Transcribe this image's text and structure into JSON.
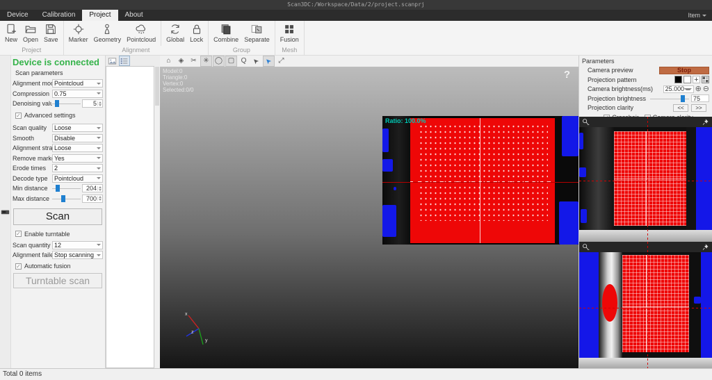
{
  "window": {
    "title": "Scan3DC:/Workspace/Data/2/project.scanprj"
  },
  "menu": {
    "tabs": [
      {
        "label": "Device",
        "active": false
      },
      {
        "label": "Calibration",
        "active": false
      },
      {
        "label": "Project",
        "active": true
      },
      {
        "label": "About",
        "active": false
      }
    ],
    "right_item": "Item"
  },
  "ribbon": {
    "groups": [
      {
        "label": "Project",
        "sections": [
          [
            {
              "label": "New",
              "icon": "new-icon"
            },
            {
              "label": "Open",
              "icon": "open-icon"
            },
            {
              "label": "Save",
              "icon": "save-icon"
            }
          ]
        ]
      },
      {
        "label": "Alignment",
        "sections": [
          [
            {
              "label": "Marker",
              "icon": "marker-icon"
            },
            {
              "label": "Geometry",
              "icon": "geometry-icon"
            },
            {
              "label": "Pointcloud",
              "icon": "pointcloud-icon"
            }
          ],
          [
            {
              "label": "Global",
              "icon": "global-icon"
            },
            {
              "label": "Lock",
              "icon": "lock-icon"
            }
          ]
        ]
      },
      {
        "label": "Group",
        "sections": [
          [
            {
              "label": "Combine",
              "icon": "combine-icon"
            },
            {
              "label": "Separate",
              "icon": "separate-icon"
            }
          ]
        ]
      },
      {
        "label": "Mesh",
        "sections": [
          [
            {
              "label": "Fusion",
              "icon": "fusion-icon"
            }
          ]
        ]
      }
    ]
  },
  "left_panel": {
    "device_status": "Device is connected",
    "section_title": "Scan parameters",
    "rows": [
      {
        "type": "select",
        "label": "Alignment mode",
        "value": "Pointcloud"
      },
      {
        "type": "select",
        "label": "Compression",
        "value": "0.75"
      },
      {
        "type": "sliderspin",
        "label": "Denoising value",
        "value": "5",
        "pos": 9
      },
      {
        "type": "checkbox",
        "label": "Advanced settings",
        "checked": true
      },
      {
        "type": "select",
        "label": "Scan quality",
        "value": "Loose"
      },
      {
        "type": "select",
        "label": "Smooth",
        "value": "Disable"
      },
      {
        "type": "select",
        "label": "Alignment strateg",
        "value": "Loose"
      },
      {
        "type": "select",
        "label": "Remove markers",
        "value": "Yes"
      },
      {
        "type": "select",
        "label": "Erode times",
        "value": "2"
      },
      {
        "type": "select",
        "label": "Decode type",
        "value": "Pointcloud"
      },
      {
        "type": "sliderspin",
        "label": "Min distance",
        "value": "204",
        "pos": 12
      },
      {
        "type": "sliderspin",
        "label": "Max distance",
        "value": "700",
        "pos": 32
      }
    ],
    "scan_button": "Scan",
    "turntable": {
      "rows": [
        {
          "type": "checkbox",
          "label": "Enable turntable",
          "checked": true
        },
        {
          "type": "select",
          "label": "Scan quantity",
          "value": "12"
        },
        {
          "type": "select",
          "label": "Alignment failed",
          "value": "Stop scanning"
        },
        {
          "type": "checkbox",
          "label": "Automatic fusion",
          "checked": true
        }
      ],
      "button": "Turntable scan"
    }
  },
  "viewport": {
    "toolbar": [
      {
        "name": "home-icon",
        "glyph": "⌂",
        "active": false
      },
      {
        "name": "standard-view-icon",
        "glyph": "◈",
        "active": false
      },
      {
        "name": "cut-icon",
        "glyph": "✂",
        "active": false
      },
      {
        "name": "pan-icon",
        "glyph": "✳",
        "active": true
      },
      {
        "name": "circle-select-icon",
        "glyph": "◯",
        "active": true
      },
      {
        "name": "polygon-select-icon",
        "glyph": "▢",
        "active": true
      },
      {
        "name": "lasso-select-icon",
        "glyph": "Q",
        "active": false
      },
      {
        "name": "pick-rect-icon",
        "glyph": "➤",
        "active": false,
        "rotate": -135
      },
      {
        "name": "pick-move-icon",
        "glyph": "➤",
        "active": true,
        "rotate": -135,
        "color": "#2a7fd4"
      },
      {
        "name": "fit-view-icon",
        "glyph": "⤢",
        "active": false
      }
    ],
    "stats": [
      "Model:0",
      "Triangle:0",
      "Vertex:0",
      "Selected:0/0"
    ],
    "help": "?",
    "camera_overlay": {
      "ratio_label": "Ratio: 100.0%"
    },
    "axis": {
      "x": "x",
      "y": "y",
      "z": "z"
    }
  },
  "right_panel": {
    "title": "Parameters",
    "camera_preview_label": "Camera preview",
    "stop_button": "Stop",
    "projection_pattern_label": "Projection pattern",
    "pattern_plus": "+",
    "camera_brightness_label": "Camera brightness(ms)",
    "camera_brightness_value": "25.000",
    "brightness_inc": "⊕",
    "brightness_dec": "⊖",
    "projection_brightness_label": "Projection brightness",
    "projection_brightness_value": "75",
    "projection_clarity_label": "Projection clarity",
    "clarity_dec": "<<",
    "clarity_inc": ">>",
    "crosshair_label": "Crosshair",
    "crosshair_checked": true,
    "camera_clarity_label": "Camera clarity",
    "camera_clarity_checked": false
  },
  "status_bar": {
    "text": "Total 0 items"
  },
  "colors": {
    "status_green": "#35b34a",
    "stop_orange": "#bf6b43",
    "slider_blue": "#1f80d0",
    "scan_red": "#ee0707",
    "scan_blue": "#1417e8",
    "ratio_teal": "#00c8b4",
    "crosshair_red": "#d40000"
  }
}
